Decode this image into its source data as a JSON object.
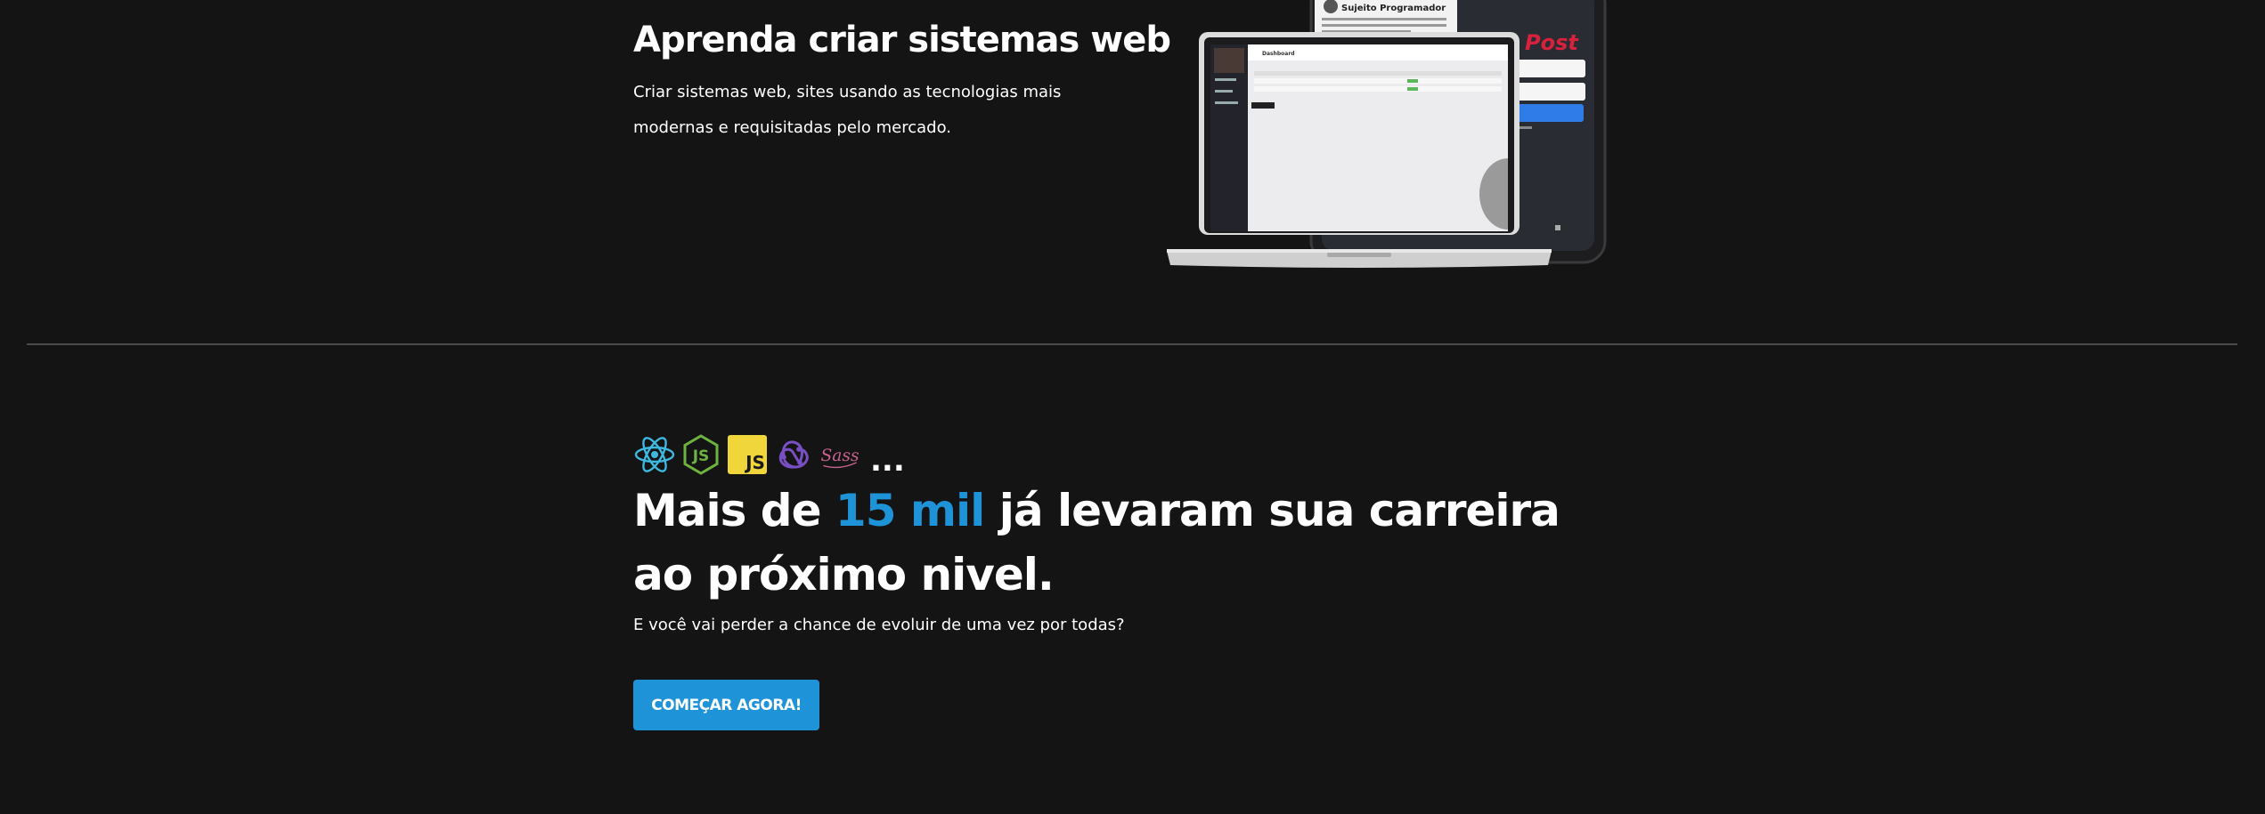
{
  "hero": {
    "title": "Aprenda criar sistemas web",
    "description": "Criar sistemas web, sites usando as tecnologias mais modernas e requisitadas pelo mercado."
  },
  "mockup": {
    "phone_profile_name": "Sujeito Programador",
    "phone_brand_text": "Post",
    "laptop_app_title": "Dashboard"
  },
  "tech_stack": {
    "icons": [
      "react-icon",
      "nodejs-icon",
      "javascript-icon",
      "redux-icon",
      "sass-icon"
    ],
    "js_label": "JS",
    "sass_label": "Sass",
    "ellipsis": "..."
  },
  "cta_section": {
    "headline_prefix": "Mais de ",
    "headline_highlight": "15 mil",
    "headline_suffix": " já levaram sua carreira ao próximo nivel.",
    "subtext": "E você vai perder a chance de evoluir de uma vez por todas?",
    "button_label": "COMEÇAR AGORA!"
  },
  "colors": {
    "background": "#141414",
    "accent": "#1f93d8",
    "text": "#ffffff"
  }
}
